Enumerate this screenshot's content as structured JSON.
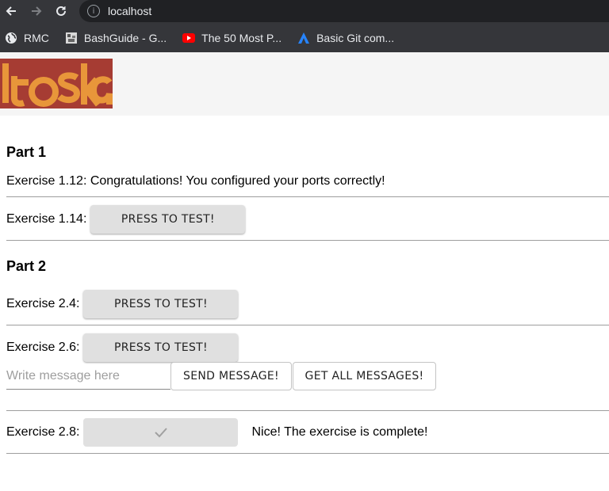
{
  "browser": {
    "url": "localhost",
    "bookmarks": [
      {
        "label": "RMC",
        "icon": "globe-icon"
      },
      {
        "label": "BashGuide - G...",
        "icon": "bashguide-favicon"
      },
      {
        "label": "The 50 Most P...",
        "icon": "youtube-icon"
      },
      {
        "label": "Basic Git com...",
        "icon": "atlassian-icon"
      }
    ]
  },
  "colors": {
    "logo_red": "#a63c33",
    "logo_orange": "#e8963a",
    "header_bg": "#f5f5f5"
  },
  "part1": {
    "title": "Part 1",
    "ex112_text": "Exercise 1.12: Congratulations! You configured your ports correctly!",
    "ex114_label": "Exercise 1.14:",
    "ex114_button": "PRESS TO TEST!"
  },
  "part2": {
    "title": "Part 2",
    "ex24_label": "Exercise 2.4:",
    "ex24_button": "PRESS TO TEST!",
    "ex26_label": "Exercise 2.6:",
    "ex26_button": "PRESS TO TEST!",
    "message_placeholder": "Write message here",
    "send_button": "SEND MESSAGE!",
    "get_button": "GET ALL MESSAGES!",
    "ex28_label": "Exercise 2.8:",
    "ex28_status": "Nice! The exercise is complete!"
  }
}
